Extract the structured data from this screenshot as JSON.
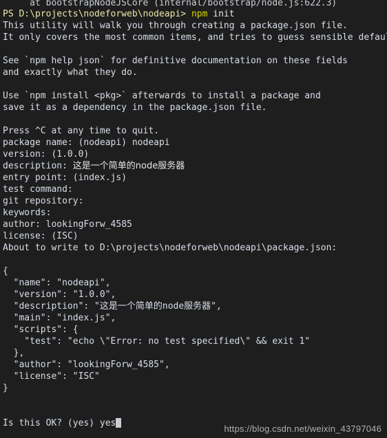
{
  "terminal": {
    "background_color": "#1e1e1e",
    "foreground_color": "#d8dee9",
    "prompt_color": "#e8e8a8",
    "command_color": "#d7d700",
    "cursor_color": "#c9ccd1",
    "partial_top_line": "     at bootstrapNodeJSCore (internal/bootstrap/node.js:622.3)",
    "prompt": {
      "path": "PS D:\\projects\\nodeforweb\\nodeapi>",
      "command": "npm",
      "args": "init"
    },
    "intro_lines": [
      "This utility will walk you through creating a package.json file.",
      "It only covers the most common items, and tries to guess sensible defaults.",
      "",
      "See `npm help json` for definitive documentation on these fields",
      "and exactly what they do.",
      "",
      "Use `npm install <pkg>` afterwards to install a package and",
      "save it as a dependency in the package.json file.",
      "",
      "Press ^C at any time to quit."
    ],
    "answers": [
      {
        "label": "package name:",
        "value": "(nodeapi) nodeapi",
        "chinese": false
      },
      {
        "label": "version:",
        "value": "(1.0.0)",
        "chinese": false
      },
      {
        "label": "description:",
        "value": "这是一个简单的node服务器",
        "chinese": true
      },
      {
        "label": "entry point:",
        "value": "(index.js)",
        "chinese": false
      },
      {
        "label": "test command:",
        "value": "",
        "chinese": false
      },
      {
        "label": "git repository:",
        "value": "",
        "chinese": false
      },
      {
        "label": "keywords:",
        "value": "",
        "chinese": false
      },
      {
        "label": "author:",
        "value": "lookingForw_4585",
        "chinese": false
      },
      {
        "label": "license:",
        "value": "(ISC)",
        "chinese": false
      }
    ],
    "about_line": "About to write to D:\\projects\\nodeforweb\\nodeapi\\package.json:",
    "package_json": {
      "open_brace": "{",
      "entries": [
        "  \"name\": \"nodeapi\",",
        "  \"version\": \"1.0.0\",",
        "  \"description\": \"这是一个简单的node服务器\",",
        "  \"main\": \"index.js\",",
        "  \"scripts\": {",
        "    \"test\": \"echo \\\"Error: no test specified\\\" && exit 1\"",
        "  },",
        "  \"author\": \"lookingForw_4585\",",
        "  \"license\": \"ISC\""
      ],
      "close_brace": "}"
    },
    "confirm": {
      "question": "Is this OK? (yes)",
      "typed_answer": "yes"
    }
  },
  "watermark": {
    "text": "https://blog.csdn.net/weixin_43797046"
  }
}
